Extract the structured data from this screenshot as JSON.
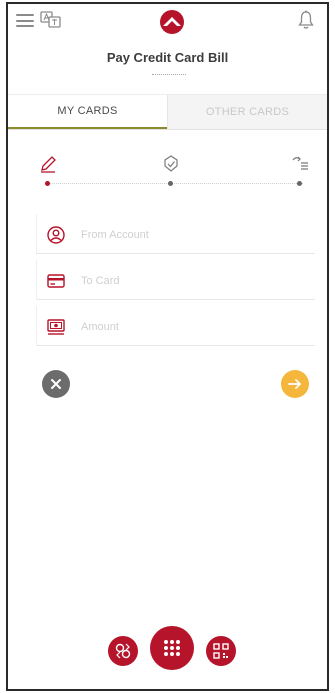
{
  "header": {
    "title": "Pay Credit Card Bill",
    "icons": [
      "menu-icon",
      "language-icon",
      "logo-icon",
      "bell-icon"
    ]
  },
  "tabs": [
    {
      "label": "MY CARDS",
      "active": true
    },
    {
      "label": "OTHER CARDS",
      "active": false
    }
  ],
  "stepper": {
    "steps": [
      "edit-icon",
      "check-shield-icon",
      "review-list-icon"
    ],
    "current_step": 1
  },
  "form": {
    "from_account": {
      "placeholder": "From Account",
      "icon": "user-circle-icon"
    },
    "to_card": {
      "placeholder": "To Card",
      "icon": "credit-card-icon"
    },
    "amount": {
      "placeholder": "Amount",
      "icon": "cash-icon"
    }
  },
  "actions": {
    "cancel": "close-icon",
    "next": "arrow-right-icon"
  },
  "colors": {
    "brand_red": "#b5142a",
    "accent_yellow": "#f4b63b",
    "cancel_gray": "#6c6c6c",
    "tab_underline": "#8b8b2e"
  },
  "bottom_nav": [
    "transfer-icon",
    "grid-menu-icon",
    "qr-code-icon"
  ]
}
